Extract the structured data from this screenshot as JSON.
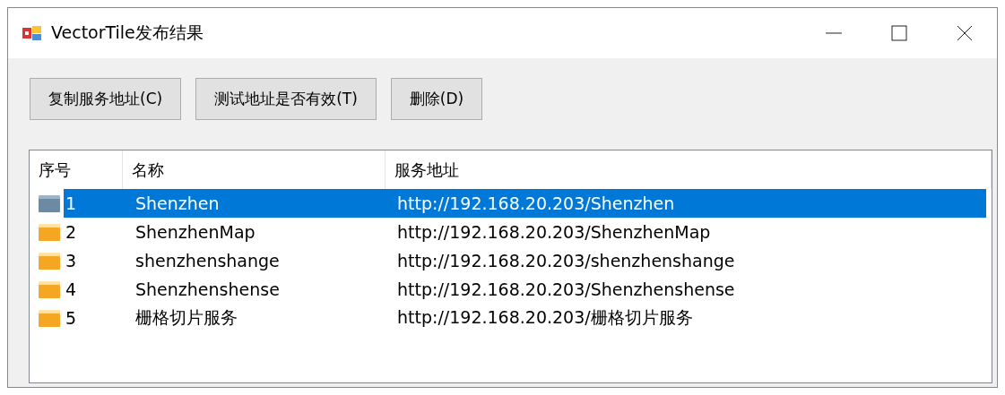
{
  "window": {
    "title": "VectorTile发布结果"
  },
  "buttons": [
    {
      "label": "复制服务地址(C)"
    },
    {
      "label": "测试地址是否有效(T)"
    },
    {
      "label": "删除(D)"
    }
  ],
  "table": {
    "columns": [
      "序号",
      "名称",
      "服务地址"
    ],
    "rows": [
      {
        "index": "1",
        "name": "Shenzhen",
        "url": "http://192.168.20.203/Shenzhen",
        "selected": true
      },
      {
        "index": "2",
        "name": "ShenzhenMap",
        "url": "http://192.168.20.203/ShenzhenMap",
        "selected": false
      },
      {
        "index": "3",
        "name": "shenzhenshange",
        "url": "http://192.168.20.203/shenzhenshange",
        "selected": false
      },
      {
        "index": "4",
        "name": "Shenzhenshense",
        "url": "http://192.168.20.203/Shenzhenshense",
        "selected": false
      },
      {
        "index": "5",
        "name": "栅格切片服务",
        "url": "http://192.168.20.203/栅格切片服务",
        "selected": false
      }
    ]
  }
}
